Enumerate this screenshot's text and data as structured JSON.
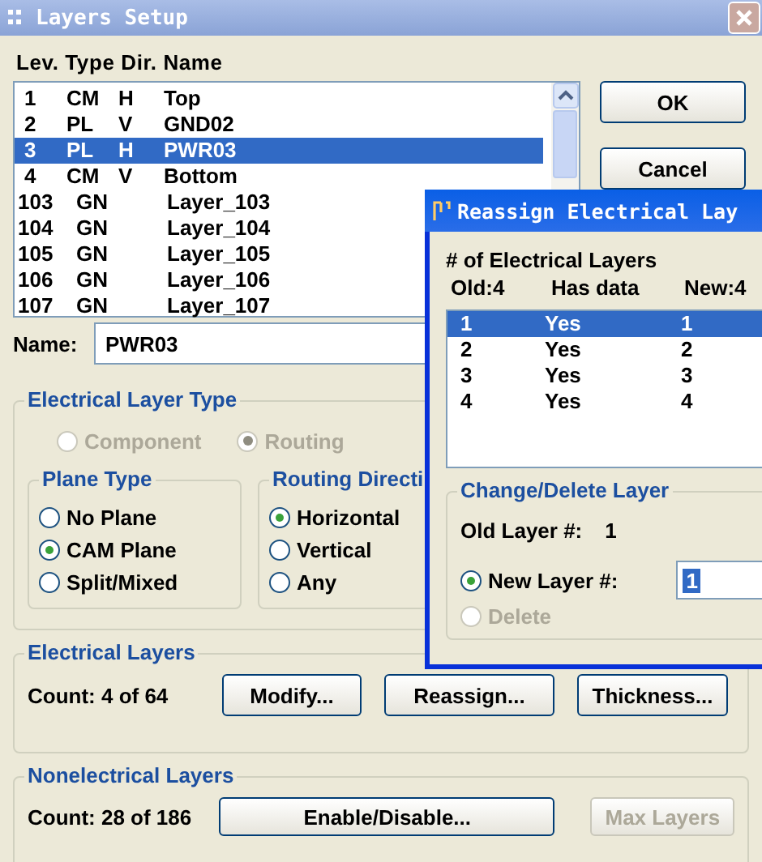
{
  "window": {
    "title": "Layers Setup"
  },
  "layer_list": {
    "header": "Lev. Type Dir. Name",
    "rows": [
      {
        "lev": "1",
        "type": "CM",
        "dir": "H",
        "name": "Top",
        "selected": false
      },
      {
        "lev": "2",
        "type": "PL",
        "dir": "V",
        "name": "GND02",
        "selected": false
      },
      {
        "lev": "3",
        "type": "PL",
        "dir": "H",
        "name": "PWR03",
        "selected": true
      },
      {
        "lev": "4",
        "type": "CM",
        "dir": "V",
        "name": "Bottom",
        "selected": false
      },
      {
        "lev": "103",
        "type": "GN",
        "name": "Layer_103",
        "selected": false
      },
      {
        "lev": "104",
        "type": "GN",
        "name": "Layer_104",
        "selected": false
      },
      {
        "lev": "105",
        "type": "GN",
        "name": "Layer_105",
        "selected": false
      },
      {
        "lev": "106",
        "type": "GN",
        "name": "Layer_106",
        "selected": false
      },
      {
        "lev": "107",
        "type": "GN",
        "name": "Layer_107",
        "selected": false
      }
    ]
  },
  "dialog_buttons": [
    "OK",
    "Cancel"
  ],
  "name_field": {
    "label": "Name:",
    "value": "PWR03"
  },
  "electrical_layer_type": {
    "title": "Electrical  Layer Type",
    "options": [
      {
        "label": "Component",
        "selected": false,
        "disabled": true
      },
      {
        "label": "Routing",
        "selected": true,
        "disabled": true
      }
    ]
  },
  "plane_type": {
    "title": "Plane Type",
    "options": [
      {
        "label": "No Plane",
        "selected": false
      },
      {
        "label": "CAM Plane",
        "selected": true
      },
      {
        "label": "Split/Mixed",
        "selected": false
      }
    ]
  },
  "routing_direction": {
    "title": "Routing Directi",
    "options": [
      {
        "label": "Horizontal",
        "selected": true
      },
      {
        "label": "Vertical",
        "selected": false
      },
      {
        "label": "Any",
        "selected": false
      }
    ]
  },
  "electrical_layers": {
    "title": "Electrical Layers",
    "count": "Count:  4 of 64",
    "buttons": [
      "Modify...",
      "Reassign...",
      "Thickness..."
    ]
  },
  "nonelectrical_layers": {
    "title": "Nonelectrical Layers",
    "count": "Count: 28 of 186",
    "buttons": [
      "Enable/Disable...",
      "Max Layers"
    ]
  },
  "reassign_window": {
    "title": "Reassign Electrical Lay",
    "count_label": "# of Electrical Layers",
    "headers": [
      "Old:4",
      "Has data",
      "New:4"
    ],
    "rows": [
      {
        "old": "1",
        "has_data": "Yes",
        "new": "1",
        "selected": true
      },
      {
        "old": "2",
        "has_data": "Yes",
        "new": "2",
        "selected": false
      },
      {
        "old": "3",
        "has_data": "Yes",
        "new": "3",
        "selected": false
      },
      {
        "old": "4",
        "has_data": "Yes",
        "new": "4",
        "selected": false
      }
    ],
    "change_group": {
      "title": "Change/Delete Layer",
      "old_layer_label": "Old Layer #:",
      "old_layer_value": "1",
      "options": [
        {
          "label": "New Layer #:",
          "selected": true,
          "disabled": false
        },
        {
          "label": "Delete",
          "selected": false,
          "disabled": true
        }
      ],
      "new_layer_value": "1"
    }
  }
}
